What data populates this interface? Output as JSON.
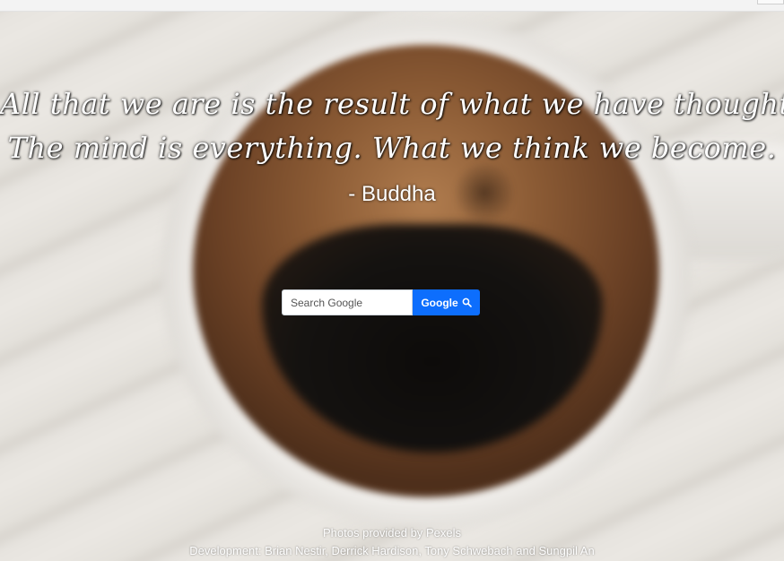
{
  "quote": {
    "line1": "All that we are is the result of what we have thought.",
    "line2": "The mind is everything. What we think we become.",
    "author": "- Buddha"
  },
  "search": {
    "placeholder": "Search Google",
    "value": "",
    "button_label": "Google",
    "button_icon": "search-icon",
    "button_color": "#0d6efd"
  },
  "footer": {
    "photos_prefix": "Photos provided by",
    "photos_link": "Pexels",
    "credits": "Development: Brian Nestir, Derrick Hardison, Tony Schwebach and Sungpil An"
  }
}
